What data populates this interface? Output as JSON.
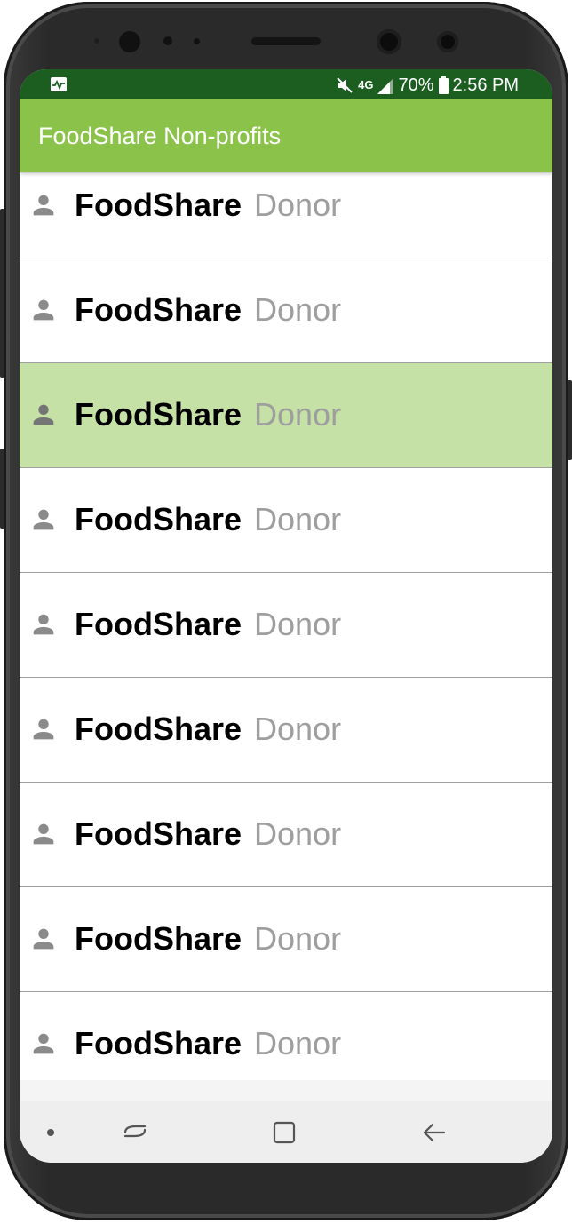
{
  "status_bar": {
    "network": "4G",
    "battery": "70%",
    "time": "2:56 PM"
  },
  "app_bar": {
    "title": "FoodShare Non-profits"
  },
  "list": {
    "items": [
      {
        "name": "FoodShare",
        "role": "Donor",
        "selected": false
      },
      {
        "name": "FoodShare",
        "role": "Donor",
        "selected": false
      },
      {
        "name": "FoodShare",
        "role": "Donor",
        "selected": true
      },
      {
        "name": "FoodShare",
        "role": "Donor",
        "selected": false
      },
      {
        "name": "FoodShare",
        "role": "Donor",
        "selected": false
      },
      {
        "name": "FoodShare",
        "role": "Donor",
        "selected": false
      },
      {
        "name": "FoodShare",
        "role": "Donor",
        "selected": false
      },
      {
        "name": "FoodShare",
        "role": "Donor",
        "selected": false
      },
      {
        "name": "FoodShare",
        "role": "Donor",
        "selected": false
      }
    ]
  },
  "icons": {
    "status_left": "activity-monitor-icon",
    "mute": "mute-icon",
    "signal": "signal-icon",
    "battery": "battery-icon",
    "item": "person-icon",
    "nav_dot": "nav-dot-icon",
    "nav_recents": "recents-icon",
    "nav_home": "home-icon",
    "nav_back": "back-icon"
  },
  "colors": {
    "status_bar": "#1b5e20",
    "app_bar": "#8bc34a",
    "selected_row": "#c5e1a5",
    "secondary_text": "#9e9e9e"
  }
}
